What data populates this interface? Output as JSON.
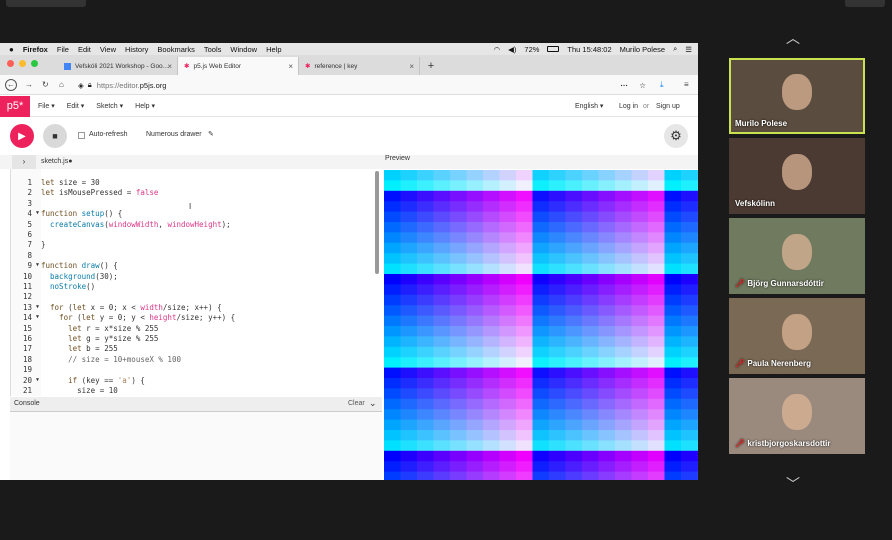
{
  "macos_menu": {
    "apple": "",
    "app": "Firefox",
    "items": [
      "File",
      "Edit",
      "View",
      "History",
      "Bookmarks",
      "Tools",
      "Window",
      "Help"
    ],
    "battery": "72%",
    "clock": "Thu 15:48:02",
    "user": "Murilo Polese"
  },
  "browser": {
    "tabs": [
      {
        "label": "Vefskóli 2021 Workshop - Goo…",
        "active": false
      },
      {
        "label": "p5.js Web Editor",
        "active": true
      },
      {
        "label": "reference | key",
        "active": false
      }
    ],
    "url_prefix": "https://editor.",
    "url_domain": "p5js.org"
  },
  "p5": {
    "logo": "p5*",
    "menus": [
      "File",
      "Edit",
      "Sketch",
      "Help"
    ],
    "language": "English",
    "login": "Log in",
    "or": "or",
    "signup": "Sign up",
    "autorefresh": "Auto-refresh",
    "sketch_name": "Numerous drawer",
    "filename": "sketch.js",
    "preview_label": "Preview",
    "console_label": "Console",
    "clear_label": "Clear"
  },
  "code_lines": [
    {
      "n": "1",
      "t": "let size = 30"
    },
    {
      "n": "2",
      "t": "let isMousePressed = false"
    },
    {
      "n": "3",
      "t": ""
    },
    {
      "n": "4",
      "t": "function setup() {"
    },
    {
      "n": "5",
      "t": "  createCanvas(windowWidth, windowHeight);"
    },
    {
      "n": "6",
      "t": ""
    },
    {
      "n": "7",
      "t": "}"
    },
    {
      "n": "8",
      "t": ""
    },
    {
      "n": "9",
      "t": "function draw() {"
    },
    {
      "n": "10",
      "t": "  background(30);"
    },
    {
      "n": "11",
      "t": "  noStroke()"
    },
    {
      "n": "12",
      "t": ""
    },
    {
      "n": "13",
      "t": "  for (let x = 0; x < width/size; x++) {"
    },
    {
      "n": "14",
      "t": "    for (let y = 0; y < height/size; y++) {"
    },
    {
      "n": "15",
      "t": "      let r = x*size % 255"
    },
    {
      "n": "16",
      "t": "      let g = y*size % 255"
    },
    {
      "n": "17",
      "t": "      let b = 255"
    },
    {
      "n": "18",
      "t": "      // size = 10+mouseX % 100"
    },
    {
      "n": "19",
      "t": ""
    },
    {
      "n": "20",
      "t": "      if (key == 'a') {"
    },
    {
      "n": "21",
      "t": "        size = 10"
    }
  ],
  "participants": [
    {
      "name": "Murilo Polese",
      "active": true,
      "muted": false,
      "bg": "#5a4c3e"
    },
    {
      "name": "Vefskólinn",
      "active": false,
      "muted": false,
      "bg": "#4a3a32"
    },
    {
      "name": "Björg Gunnarsdóttir",
      "active": false,
      "muted": true,
      "bg": "#6f7a5f"
    },
    {
      "name": "Paula Nerenberg",
      "active": false,
      "muted": true,
      "bg": "#7a6a55"
    },
    {
      "name": "kristbjorgoskarsdottir",
      "active": false,
      "muted": true,
      "bg": "#9a8a7e"
    }
  ],
  "colors": {
    "p5_pink": "#ed225d",
    "active_speaker": "#c9e24e"
  }
}
